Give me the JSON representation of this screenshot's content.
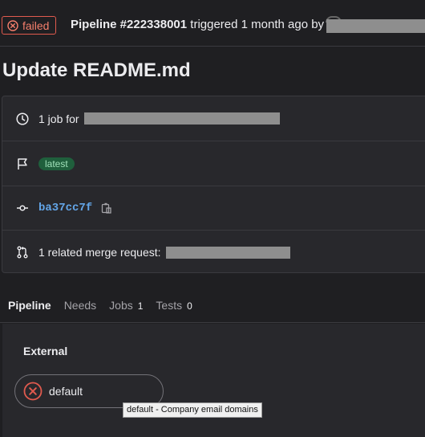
{
  "header": {
    "status": "failed",
    "pipeline_id": "Pipeline #222338001",
    "triggered_text": "triggered 1 month ago by"
  },
  "page_title": "Update README.md",
  "info": {
    "jobs_text": "1 job for",
    "latest_label": "latest",
    "commit_sha": "ba37cc7f",
    "merge_request_text": "1 related merge request:"
  },
  "tabs": [
    {
      "label": "Pipeline",
      "count": ""
    },
    {
      "label": "Needs",
      "count": ""
    },
    {
      "label": "Jobs",
      "count": "1"
    },
    {
      "label": "Tests",
      "count": "0"
    }
  ],
  "graph": {
    "stage_title": "External",
    "job_name": "default",
    "tooltip": "default - Company email domains"
  },
  "colors": {
    "failed": "#e05a4e",
    "link": "#63a6e9",
    "latest_bg": "#1f5f3c"
  }
}
